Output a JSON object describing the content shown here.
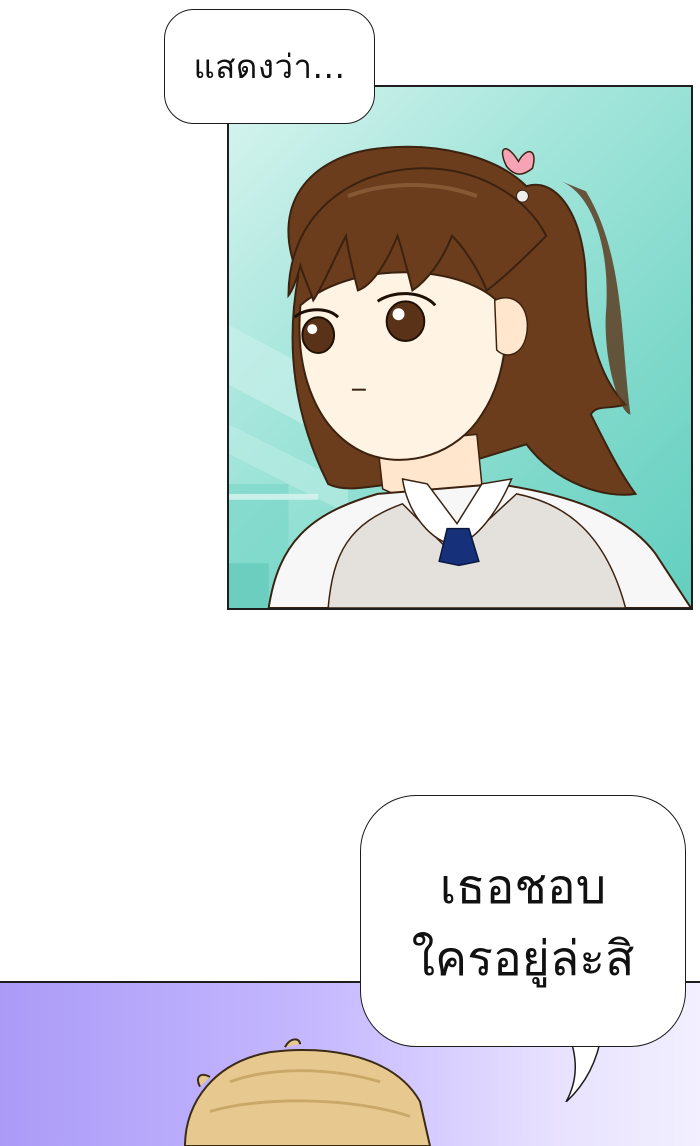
{
  "speech": {
    "bubble_1": "แสดงว่า...",
    "bubble_2_line_1": "เธอชอบ",
    "bubble_2_line_2": "ใครอยู่ล่ะสิ"
  },
  "colors": {
    "panel_1_background": "#7fd9cb",
    "panel_2_background": "#c5b8ff",
    "hair": "#6b3d1c",
    "skin": "#fff3e3",
    "vest": "#e4e0dc",
    "tie": "#16307a",
    "hair_bow": "#f5a3b5",
    "boy_hair": "#e7c98f"
  }
}
